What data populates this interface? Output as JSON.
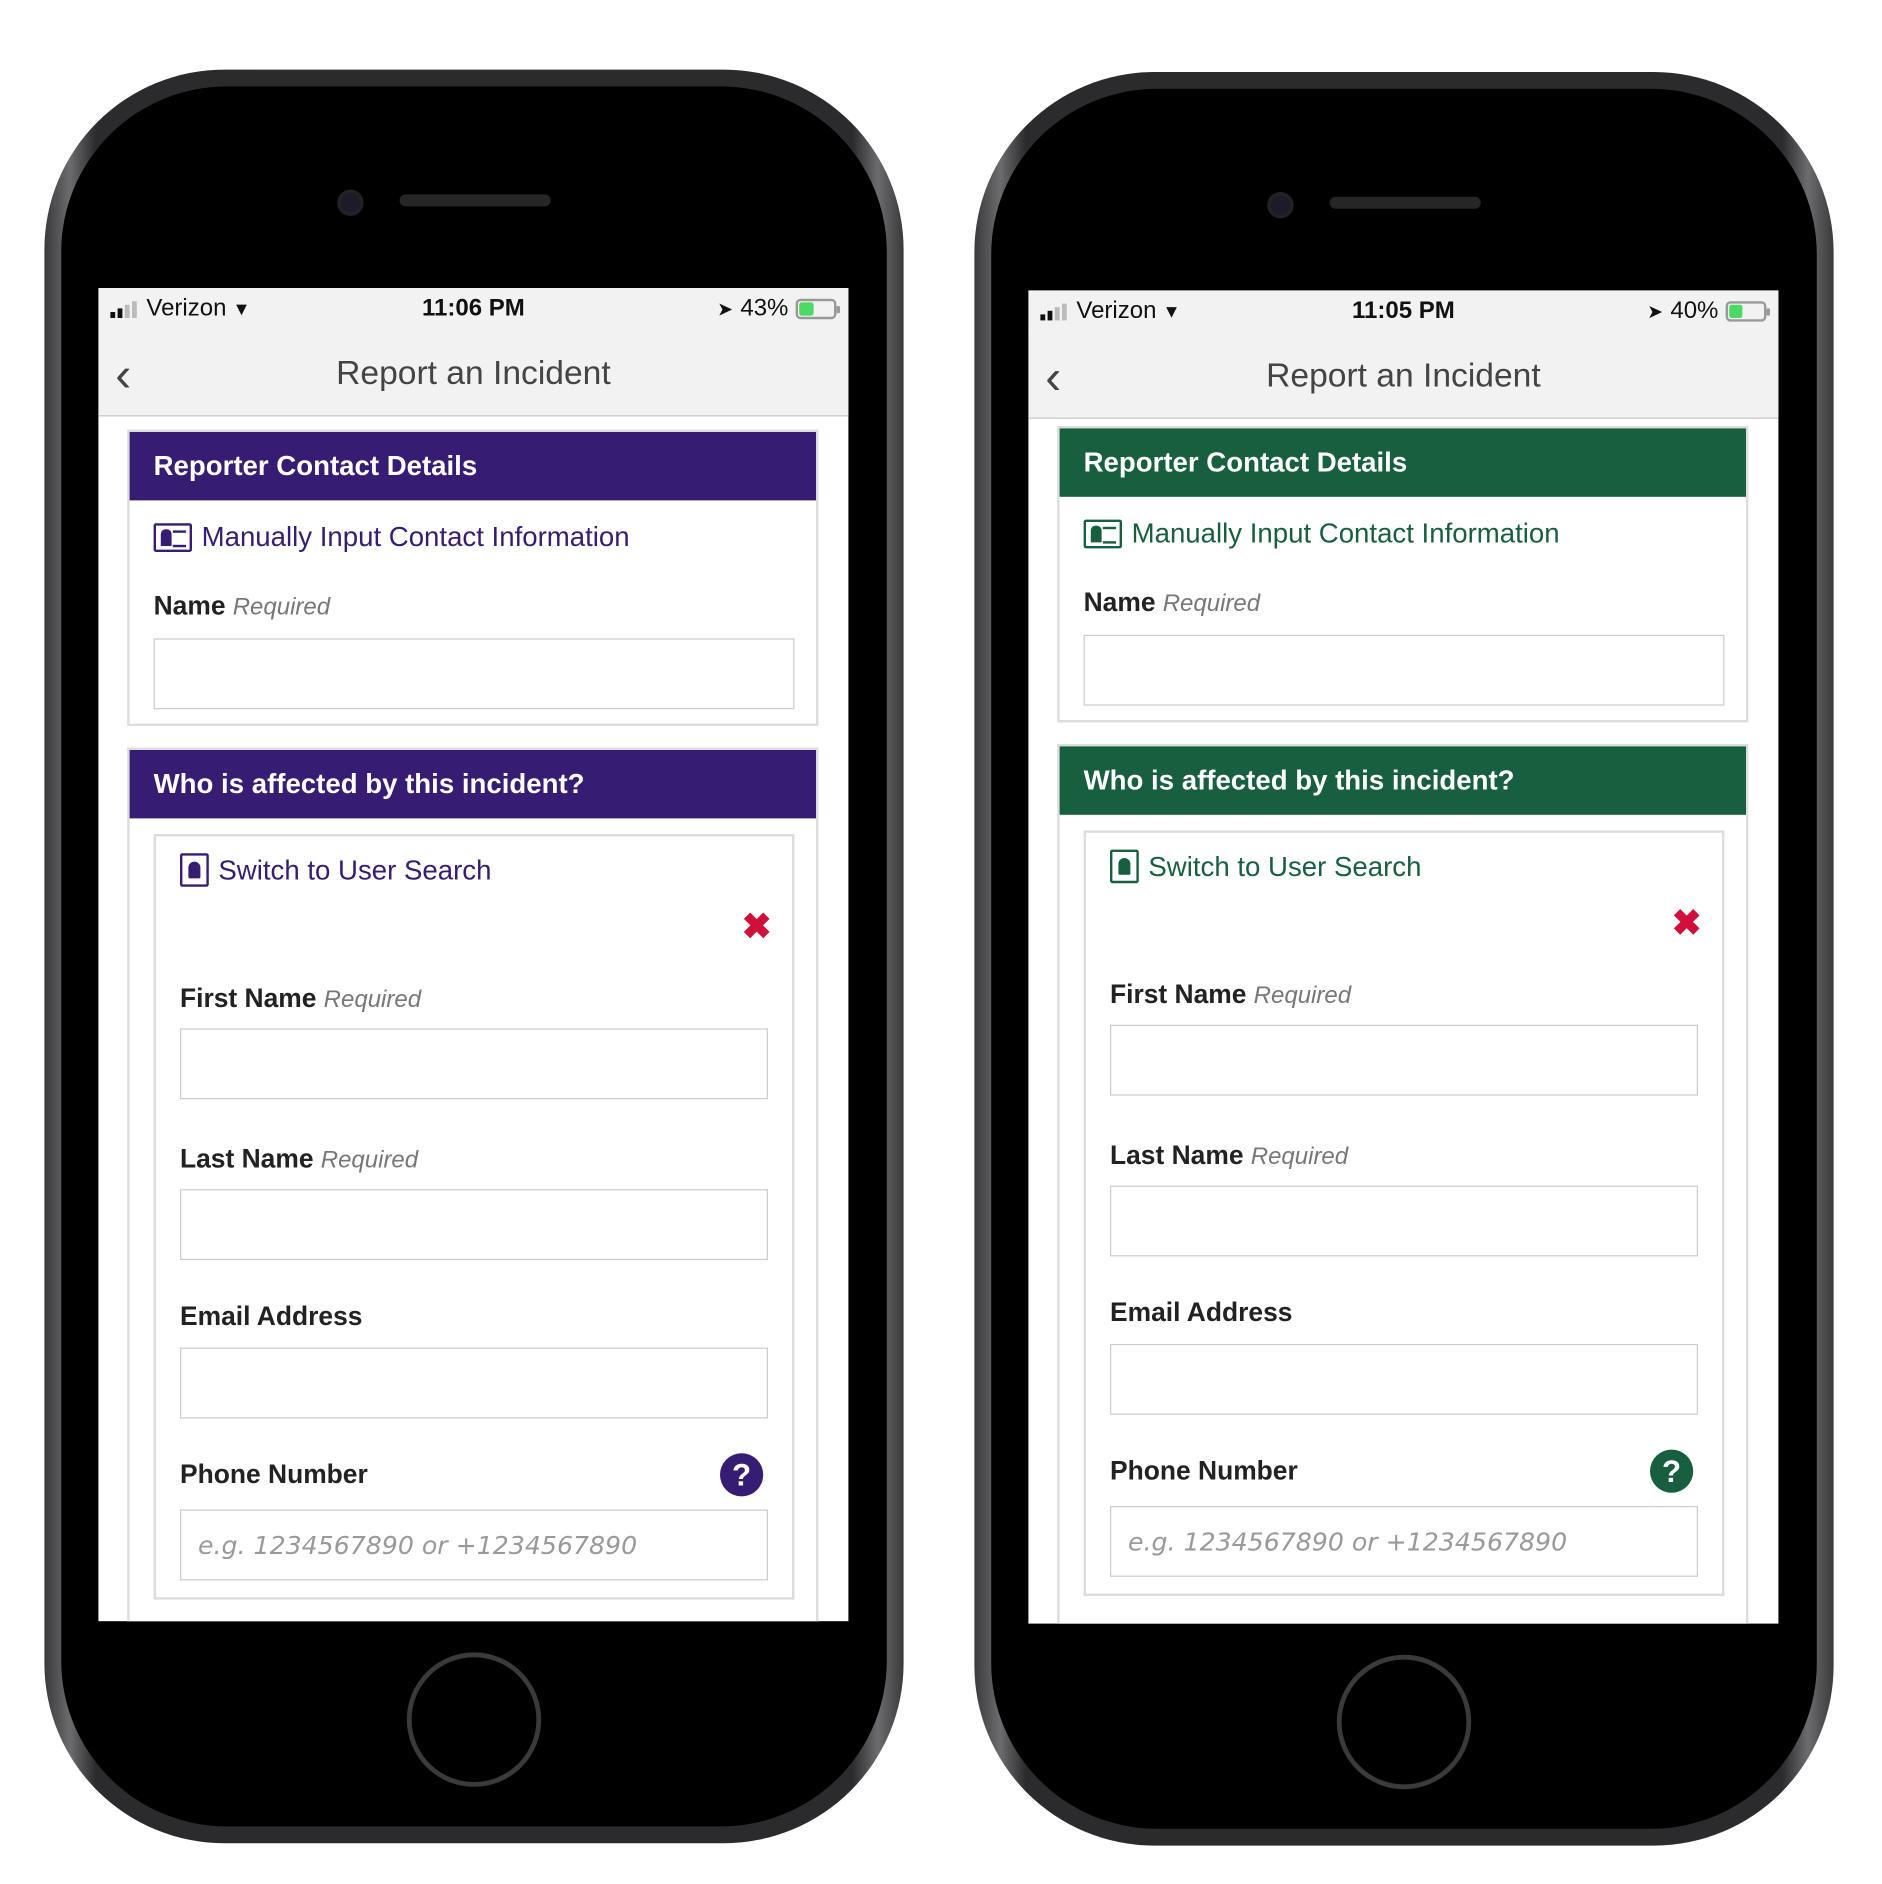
{
  "phones": [
    {
      "accent": "#371c73",
      "carrier": "Verizon",
      "time": "11:06 PM",
      "battery": "43%",
      "battery_level": 43,
      "nav": {
        "back_icon": "chevron-left",
        "title": "Report an Incident"
      },
      "reporter": {
        "header": "Reporter Contact Details",
        "manual_link": "Manually Input Contact Information",
        "name_label": "Name",
        "required": "Required"
      },
      "affected": {
        "header": "Who is affected by this incident?",
        "switch_link": "Switch to User Search",
        "remove_icon": "x-icon",
        "first_name": "First Name",
        "last_name": "Last Name",
        "required": "Required",
        "email": "Email Address",
        "phone": "Phone Number",
        "help_icon": "?",
        "phone_placeholder": "e.g. 1234567890 or +1234567890"
      }
    },
    {
      "accent": "#175f3f",
      "carrier": "Verizon",
      "time": "11:05 PM",
      "battery": "40%",
      "battery_level": 40,
      "nav": {
        "back_icon": "chevron-left",
        "title": "Report an Incident"
      },
      "reporter": {
        "header": "Reporter Contact Details",
        "manual_link": "Manually Input Contact Information",
        "name_label": "Name",
        "required": "Required"
      },
      "affected": {
        "header": "Who is affected by this incident?",
        "switch_link": "Switch to User Search",
        "remove_icon": "x-icon",
        "first_name": "First Name",
        "last_name": "Last Name",
        "required": "Required",
        "email": "Email Address",
        "phone": "Phone Number",
        "help_icon": "?",
        "phone_placeholder": "e.g. 1234567890 or +1234567890"
      }
    }
  ]
}
